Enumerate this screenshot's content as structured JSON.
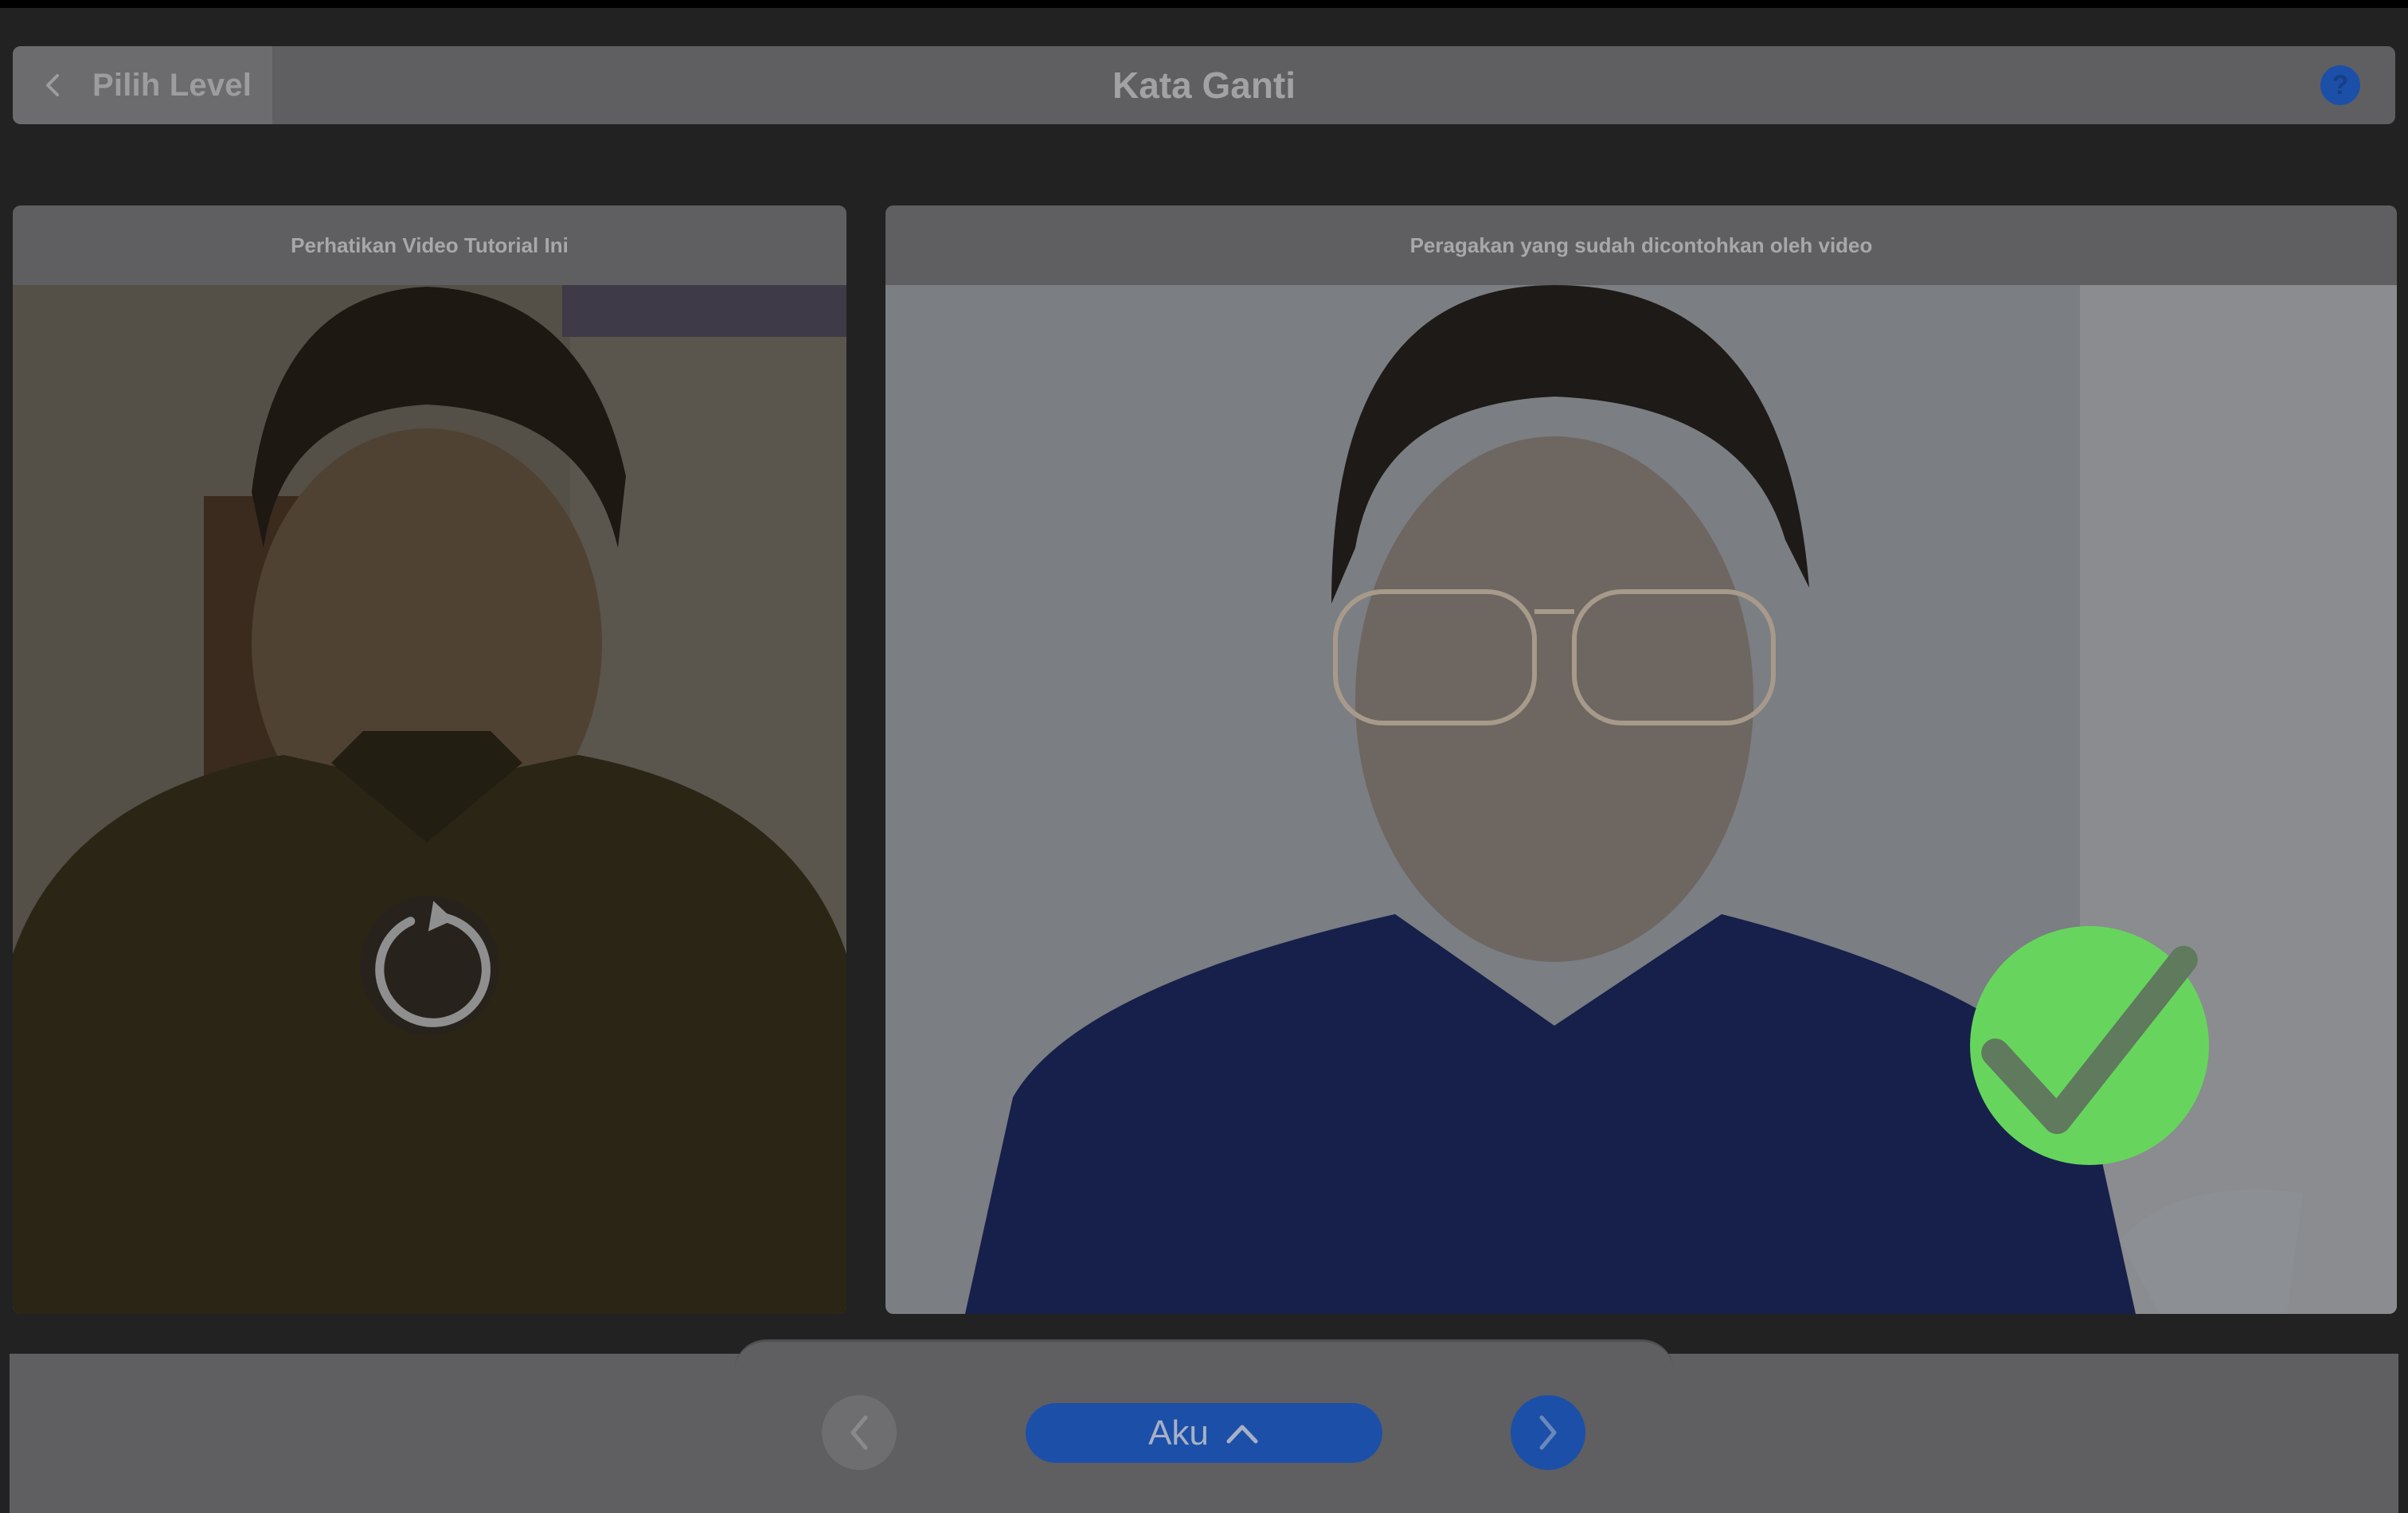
{
  "header": {
    "back_label": "Pilih Level",
    "title": "Kata Ganti",
    "help_symbol": "?"
  },
  "left_panel": {
    "header": "Perhatikan Video Tutorial Ini",
    "overlay_icon": "replay-icon"
  },
  "right_panel": {
    "header": "Peragakan yang sudah dicontohkan oleh video",
    "overlay_icon": "checkmark-icon"
  },
  "footer": {
    "prev_icon": "chevron-left-icon",
    "current_word": "Aku",
    "word_icon": "chevron-up-icon",
    "next_icon": "chevron-right-icon"
  },
  "colors": {
    "accent_blue": "#1c4fa8",
    "success_green": "#67d55d",
    "panel_gray": "#5f5f61",
    "background": "#222222"
  }
}
